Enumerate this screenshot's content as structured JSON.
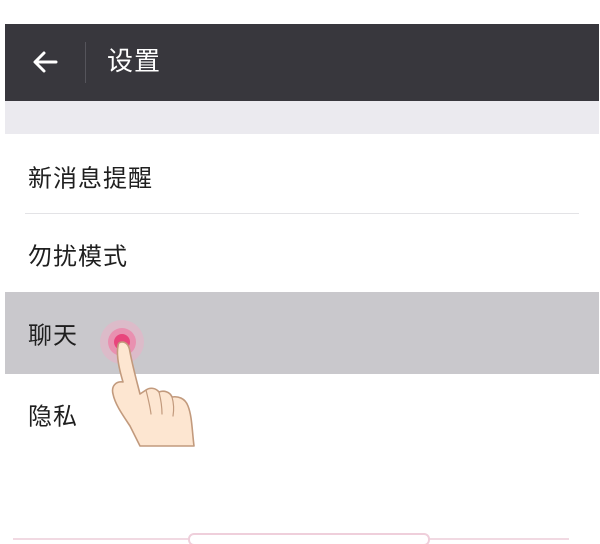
{
  "header": {
    "title": "设置",
    "back_icon": "arrow-left-icon"
  },
  "menu": {
    "items": [
      {
        "label": "新消息提醒",
        "pressed": false
      },
      {
        "label": "勿扰模式",
        "pressed": false
      },
      {
        "label": "聊天",
        "pressed": true
      },
      {
        "label": "隐私",
        "pressed": false
      }
    ]
  },
  "overlay": {
    "icon": "tap-hand-icon"
  },
  "colors": {
    "titlebar": "#38373d",
    "section_gap": "#ebeaef",
    "pressed_row": "#c9c8cc",
    "tap_indicator": "#e8457c"
  }
}
